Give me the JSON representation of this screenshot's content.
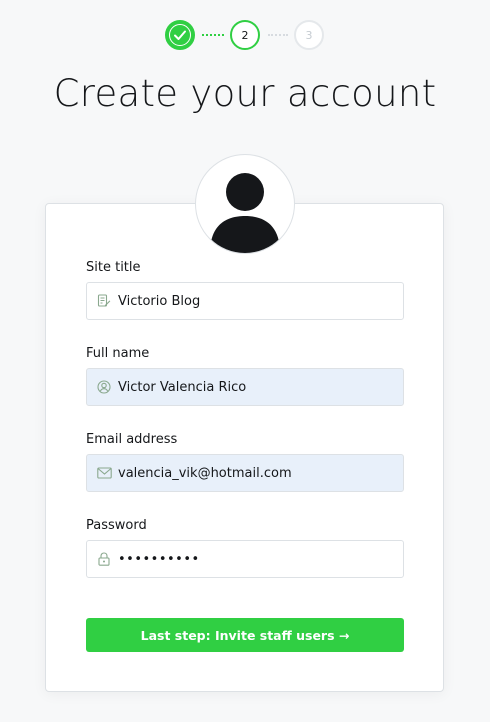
{
  "steps": {
    "step1": "",
    "step2": "2",
    "step3": "3"
  },
  "page_title": "Create your account",
  "form": {
    "site_title": {
      "label": "Site title",
      "value": "Victorio Blog",
      "icon": "pencil-doc-icon"
    },
    "full_name": {
      "label": "Full name",
      "value": "Victor Valencia Rico",
      "icon": "user-circle-icon"
    },
    "email": {
      "label": "Email address",
      "value": "valencia_vik@hotmail.com",
      "icon": "envelope-icon"
    },
    "password": {
      "label": "Password",
      "value": "••••••••••",
      "icon": "lock-icon"
    }
  },
  "submit_label": "Last step: Invite staff users →",
  "colors": {
    "accent": "#30cf43",
    "autofill_bg": "#e8f0fa",
    "border": "#dde1e5"
  }
}
